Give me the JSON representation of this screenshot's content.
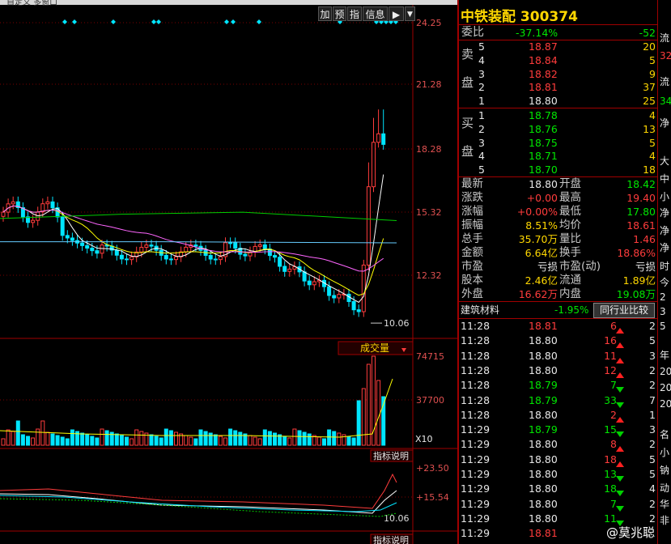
{
  "top_tab": "自定义 多窗口",
  "toolbar": {
    "add": "加",
    "predict": "预",
    "index": "指",
    "info": "信息",
    "dropdown": "▼"
  },
  "price_axis": [
    "24.25",
    "21.28",
    "18.28",
    "15.32",
    "12.32"
  ],
  "low_mark": "10.06",
  "volume_axis": [
    "74715",
    "37700",
    "X10"
  ],
  "volume_dropdown": "成交量",
  "indicator_label_1": "指标说明",
  "indicator_axis": [
    "+23.50",
    "+15.54",
    "10.06"
  ],
  "indicator_label_2": "指标说明",
  "stock": {
    "name": "中铁装配",
    "code": "300374"
  },
  "weibi": {
    "label": "委比",
    "value": "-37.14%",
    "diff": "-52"
  },
  "sell": {
    "label1": "卖",
    "label2": "盘",
    "rows": [
      {
        "level": "5",
        "price": "18.87",
        "vol": "20"
      },
      {
        "level": "4",
        "price": "18.84",
        "vol": "5"
      },
      {
        "level": "3",
        "price": "18.82",
        "vol": "9"
      },
      {
        "level": "2",
        "price": "18.81",
        "vol": "37"
      },
      {
        "level": "1",
        "price": "18.80",
        "vol": "25"
      }
    ]
  },
  "buy": {
    "label1": "买",
    "label2": "盘",
    "rows": [
      {
        "level": "1",
        "price": "18.78",
        "vol": "4"
      },
      {
        "level": "2",
        "price": "18.76",
        "vol": "13"
      },
      {
        "level": "3",
        "price": "18.75",
        "vol": "5"
      },
      {
        "level": "4",
        "price": "18.71",
        "vol": "4"
      },
      {
        "level": "5",
        "price": "18.70",
        "vol": "18"
      }
    ]
  },
  "stats": [
    {
      "l1": "最新",
      "v1": "18.80",
      "l2": "开盘",
      "v2": "18.42"
    },
    {
      "l1": "涨跌",
      "v1": "+0.00",
      "l2": "最高",
      "v2": "19.40"
    },
    {
      "l1": "涨幅",
      "v1": "+0.00%",
      "l2": "最低",
      "v2": "17.80"
    },
    {
      "l1": "振幅",
      "v1": "8.51%",
      "l2": "均价",
      "v2": "18.61"
    },
    {
      "l1": "总手",
      "v1": "35.70万",
      "l2": "量比",
      "v2": "1.46"
    },
    {
      "l1": "金额",
      "v1": "6.64亿",
      "l2": "换手",
      "v2": "18.86%"
    },
    {
      "l1": "市盈",
      "v1": "亏损",
      "l2": "市盈(动)",
      "v2": "亏损"
    },
    {
      "l1": "股本",
      "v1": "2.46亿",
      "l2": "流通",
      "v2": "1.89亿"
    },
    {
      "l1": "外盘",
      "v1": "16.62万",
      "l2": "内盘",
      "v2": "19.08万"
    }
  ],
  "industry": {
    "name": "建筑材料",
    "change": "-1.95%",
    "button": "同行业比较"
  },
  "ticks": [
    {
      "time": "11:28",
      "price": "18.81",
      "vol": "6",
      "dir": "up",
      "n": "2"
    },
    {
      "time": "11:28",
      "price": "18.80",
      "vol": "16",
      "dir": "up",
      "n": "5"
    },
    {
      "time": "11:28",
      "price": "18.80",
      "vol": "11",
      "dir": "up",
      "n": "3"
    },
    {
      "time": "11:28",
      "price": "18.80",
      "vol": "12",
      "dir": "up",
      "n": "2"
    },
    {
      "time": "11:28",
      "price": "18.79",
      "vol": "7",
      "dir": "down",
      "n": "2"
    },
    {
      "time": "11:28",
      "price": "18.79",
      "vol": "33",
      "dir": "down",
      "n": "7"
    },
    {
      "time": "11:28",
      "price": "18.80",
      "vol": "2",
      "dir": "up",
      "n": "1"
    },
    {
      "time": "11:29",
      "price": "18.79",
      "vol": "15",
      "dir": "down",
      "n": "3"
    },
    {
      "time": "11:29",
      "price": "18.80",
      "vol": "8",
      "dir": "up",
      "n": "2"
    },
    {
      "time": "11:29",
      "price": "18.80",
      "vol": "18",
      "dir": "up",
      "n": "5"
    },
    {
      "time": "11:29",
      "price": "18.80",
      "vol": "13",
      "dir": "down",
      "n": "5"
    },
    {
      "time": "11:29",
      "price": "18.80",
      "vol": "18",
      "dir": "down",
      "n": "4"
    },
    {
      "time": "11:29",
      "price": "18.80",
      "vol": "7",
      "dir": "down",
      "n": "2"
    },
    {
      "time": "11:29",
      "price": "18.80",
      "vol": "11",
      "dir": "down",
      "n": "2"
    },
    {
      "time": "11:29",
      "price": "18.81",
      "vol": "",
      "dir": "",
      "n": ""
    }
  ],
  "side_chars": [
    {
      "t": "流",
      "c": ""
    },
    {
      "t": "32",
      "c": "r"
    },
    {
      "t": "流",
      "c": ""
    },
    {
      "t": "34",
      "c": "g"
    },
    {
      "t": "净",
      "c": ""
    },
    {
      "t": "大",
      "c": ""
    },
    {
      "t": "中",
      "c": ""
    },
    {
      "t": "小",
      "c": ""
    },
    {
      "t": "净",
      "c": ""
    },
    {
      "t": "净",
      "c": ""
    },
    {
      "t": "净",
      "c": ""
    },
    {
      "t": "时",
      "c": ""
    },
    {
      "t": "今",
      "c": ""
    },
    {
      "t": "2",
      "c": ""
    },
    {
      "t": "3",
      "c": ""
    },
    {
      "t": "5",
      "c": ""
    },
    {
      "t": "年",
      "c": ""
    },
    {
      "t": "20",
      "c": ""
    },
    {
      "t": "20",
      "c": ""
    },
    {
      "t": "20",
      "c": ""
    },
    {
      "t": "名",
      "c": ""
    },
    {
      "t": "小",
      "c": ""
    },
    {
      "t": "钠",
      "c": ""
    },
    {
      "t": "动",
      "c": ""
    },
    {
      "t": "华",
      "c": ""
    },
    {
      "t": "非",
      "c": ""
    }
  ],
  "watermark": "@莫兆聪",
  "colors": {
    "up": "#ff3c3c",
    "down": "#00e600",
    "grid": "#a00000",
    "gold": "#ffd700"
  }
}
